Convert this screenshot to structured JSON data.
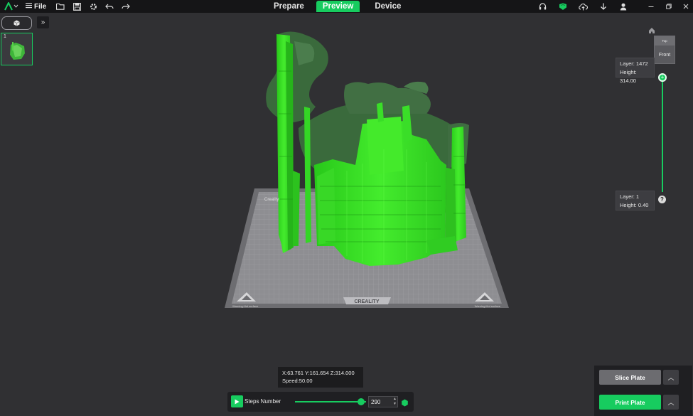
{
  "topbar": {
    "file_label": "File",
    "tabs": [
      {
        "label": "Prepare",
        "active": false
      },
      {
        "label": "Preview",
        "active": true
      },
      {
        "label": "Device",
        "active": false
      }
    ]
  },
  "left": {
    "plate_number": "1",
    "collapse_glyph": "»"
  },
  "view_cube": {
    "top_label": "Top",
    "front_label": "Front"
  },
  "layer_top": {
    "layer": "Layer: 1472",
    "height": "Height: 314.00"
  },
  "layer_bottom": {
    "layer": "Layer: 1",
    "height": "Height: 0.40"
  },
  "help_label": "?",
  "position_readout": {
    "line1": "X:63.761  Y:161.654  Z:314.000",
    "line2": "Speed:50.00"
  },
  "player": {
    "steps_label": "Steps Number",
    "steps_value": "290",
    "steps_progress": 0.93
  },
  "bed": {
    "brand": "CREALITY",
    "corner_left": "Warning:Hot surface",
    "corner_right": "Warning:Hot surface",
    "top_label": "Creality"
  },
  "actions": {
    "slice_label": "Slice Plate",
    "print_label": "Print Plate"
  },
  "colors": {
    "accent": "#17cc5f",
    "model_bright": "#33e022",
    "model_dark": "#3a6a3c",
    "bed": "#8a8a8e",
    "background": "#303033"
  },
  "icons": [
    "logo-icon",
    "folder-icon",
    "save-icon",
    "settings-icon",
    "undo-icon",
    "redo-icon",
    "headset-icon",
    "device-icon",
    "cloud-icon",
    "download-icon",
    "user-icon",
    "minimize-icon",
    "restore-icon",
    "close-icon",
    "cube-icon",
    "home-icon",
    "play-icon"
  ]
}
